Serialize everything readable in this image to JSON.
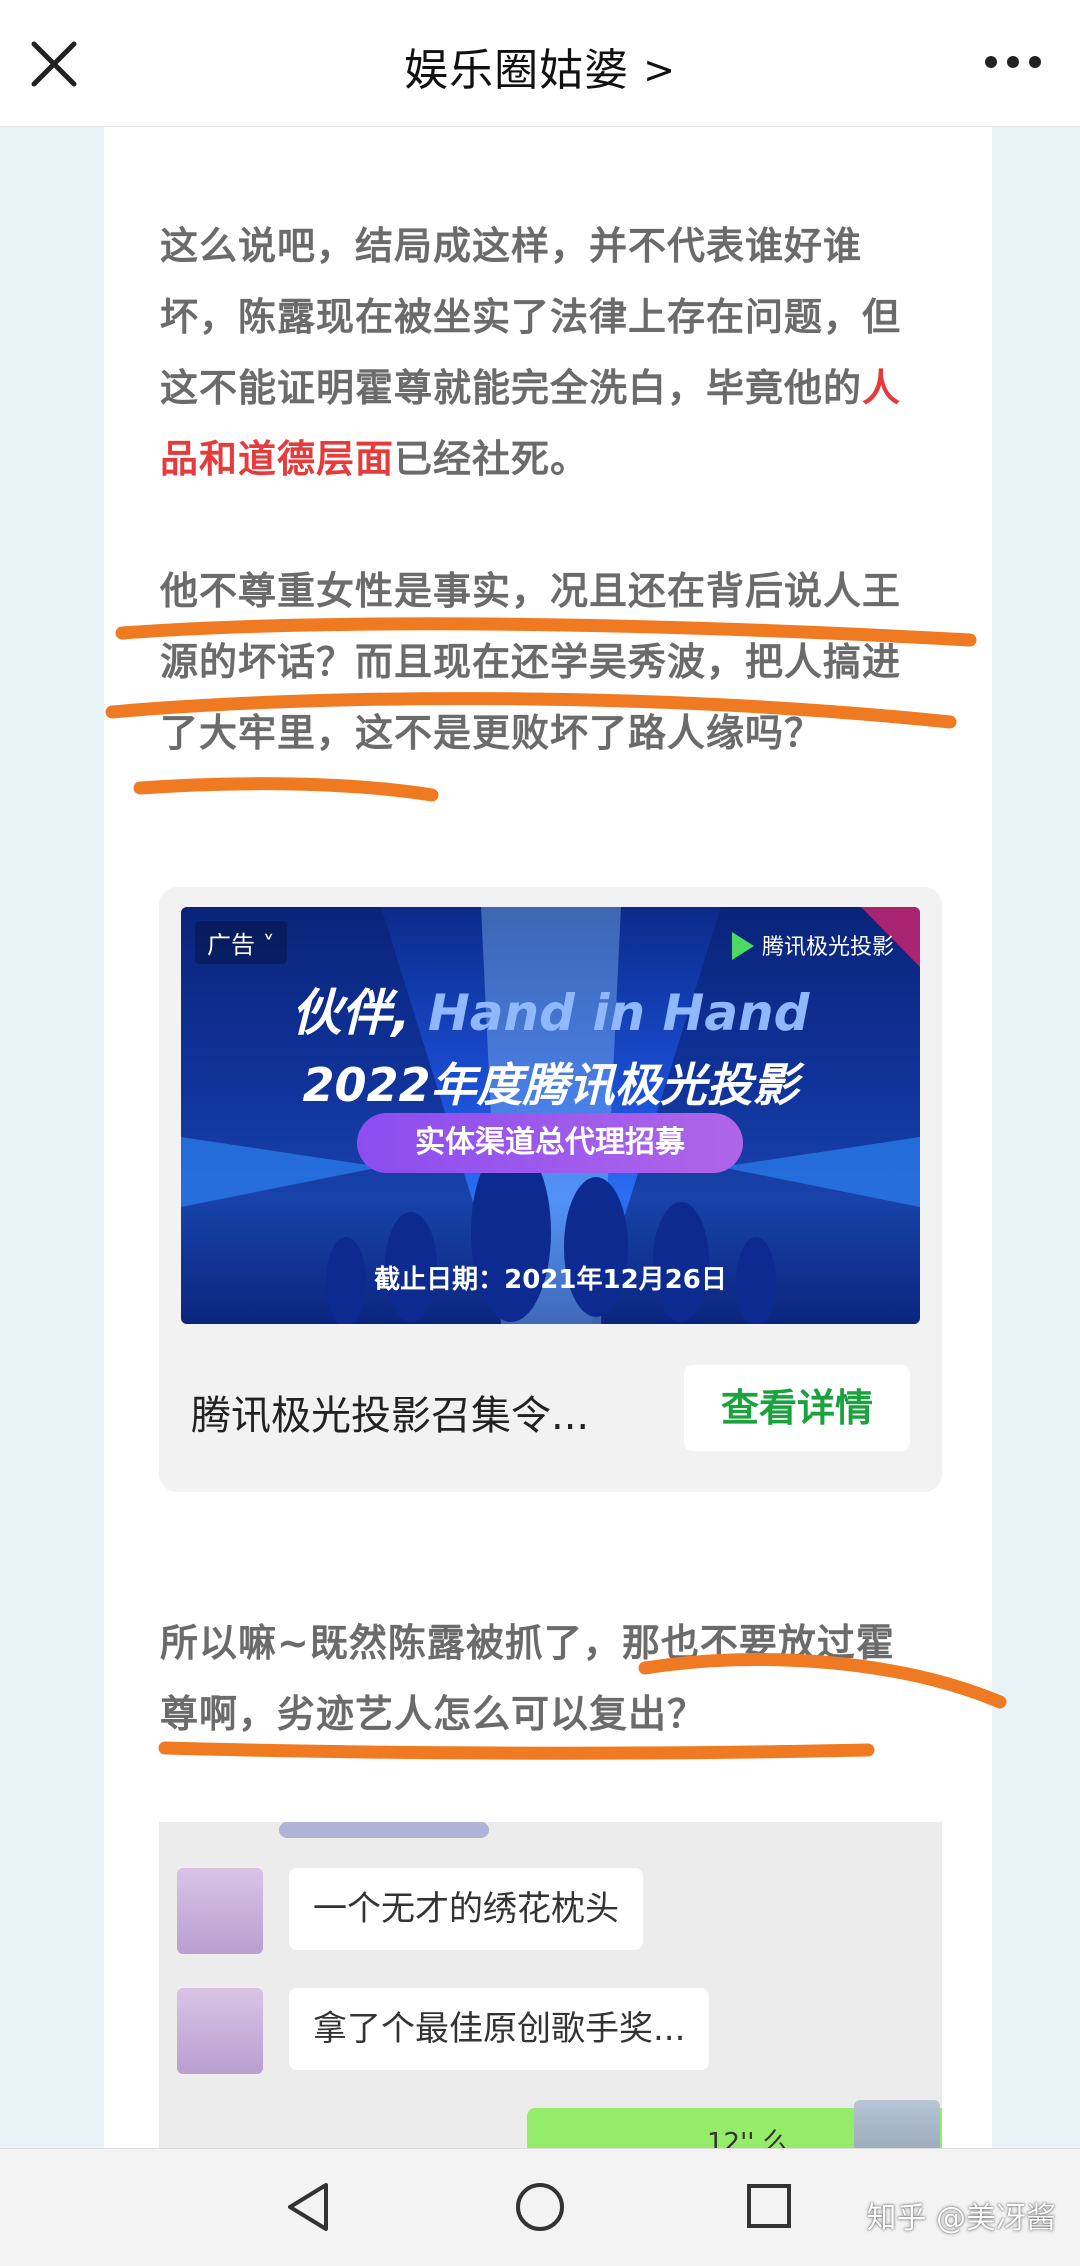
{
  "header": {
    "title": "娱乐圈姑婆",
    "chevron": ">",
    "close_icon": "close-icon",
    "more_icon": "more-icon"
  },
  "article": {
    "p1_text_a": "这么说吧，结局成这样，并不代表谁好谁坏，陈露现在被坐实了法律上存在问题，但这不能证明霍尊就能完全洗白，毕竟他的",
    "p1_highlight": "人品和道德层面",
    "p1_text_b": "已经社死。",
    "p2_text": "他不尊重女性是事实，况且还在背后说人王源的坏话？而且现在还学吴秀波，把人搞进了大牢里，这不是更败坏了路人缘吗？",
    "p3_text": "所以嘛~既然陈露被抓了，那也不要放过霍尊啊，劣迹艺人怎么可以复出？",
    "highlight_color": "#e53b3b",
    "underline_color": "#f07a22"
  },
  "ad": {
    "tag": "广告",
    "brand": "腾讯极光投影",
    "headline_cn": "伙伴,",
    "headline_en": "Hand in Hand",
    "subheadline": "2022年度腾讯极光投影",
    "pill": "实体渠道总代理招募",
    "deadline": "截止日期：2021年12月26日",
    "footer_title": "腾讯极光投影召集令...",
    "cta": "查看详情",
    "cta_color": "#1aa33d"
  },
  "chat": {
    "messages": [
      {
        "text": "一个无才的绣花枕头"
      },
      {
        "text": "拿了个最佳原创歌手奖..."
      }
    ],
    "partial_green": "12'' 么"
  },
  "navbar": {
    "back_icon": "back-triangle-icon",
    "home_icon": "home-circle-icon",
    "recent_icon": "recent-square-icon",
    "watermark": "知乎 @美冴酱"
  }
}
